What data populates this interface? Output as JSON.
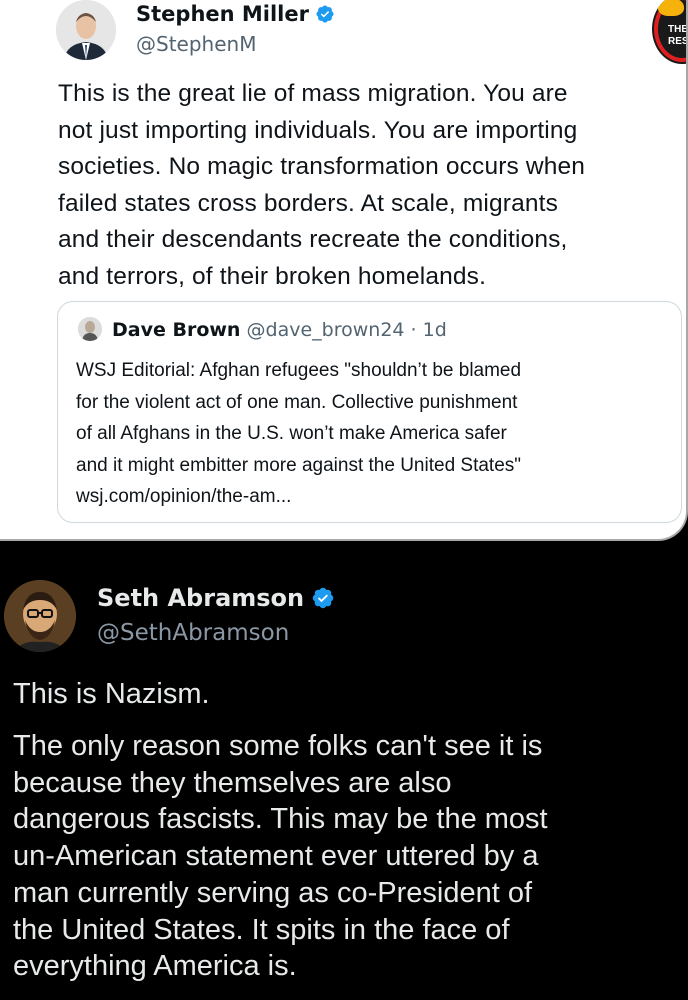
{
  "main_tweet": {
    "name": "Stephen Miller",
    "handle": "@StephenM",
    "verified": true,
    "body_lines": [
      "This is the great lie of mass migration. You are",
      "not just importing individuals. You are importing",
      "societies. No magic transformation occurs when",
      "failed states cross borders. At scale, migrants",
      "and their descendants recreate the conditions,",
      "and terrors, of their broken homelands."
    ],
    "quoted": {
      "name": "Dave Brown",
      "handle": "@dave_brown24",
      "meta": "@dave_brown24 · 1d",
      "age": "1d",
      "body_lines": [
        "WSJ Editorial: Afghan refugees \"shouldn’t be blamed",
        "for the violent act of one man. Collective punishment",
        "of all Afghans in the U.S. won’t make America safer",
        "and it might embitter more against the United States\"",
        "wsj.com/opinion/the-am..."
      ]
    },
    "corner_badge_text": [
      "THE",
      "RES"
    ]
  },
  "reply_tweet": {
    "name": "Seth Abramson",
    "handle": "@SethAbramson",
    "verified": true,
    "paragraph1": "This is Nazism.",
    "paragraph2_lines": [
      "The only reason some folks can't see it is",
      "because they themselves are also",
      "dangerous fascists. This may be the most",
      "un-American statement ever uttered by a",
      "man currently serving as co-President of",
      "the United States. It spits in the face of",
      "everything America is."
    ]
  },
  "colors": {
    "verified_blue": "#1d9bf0",
    "top_text": "#0f1419",
    "top_secondary": "#536471",
    "bottom_text": "#e7e9ea",
    "bottom_secondary": "#8b98a5"
  },
  "icons": [
    "verified-badge-icon"
  ]
}
